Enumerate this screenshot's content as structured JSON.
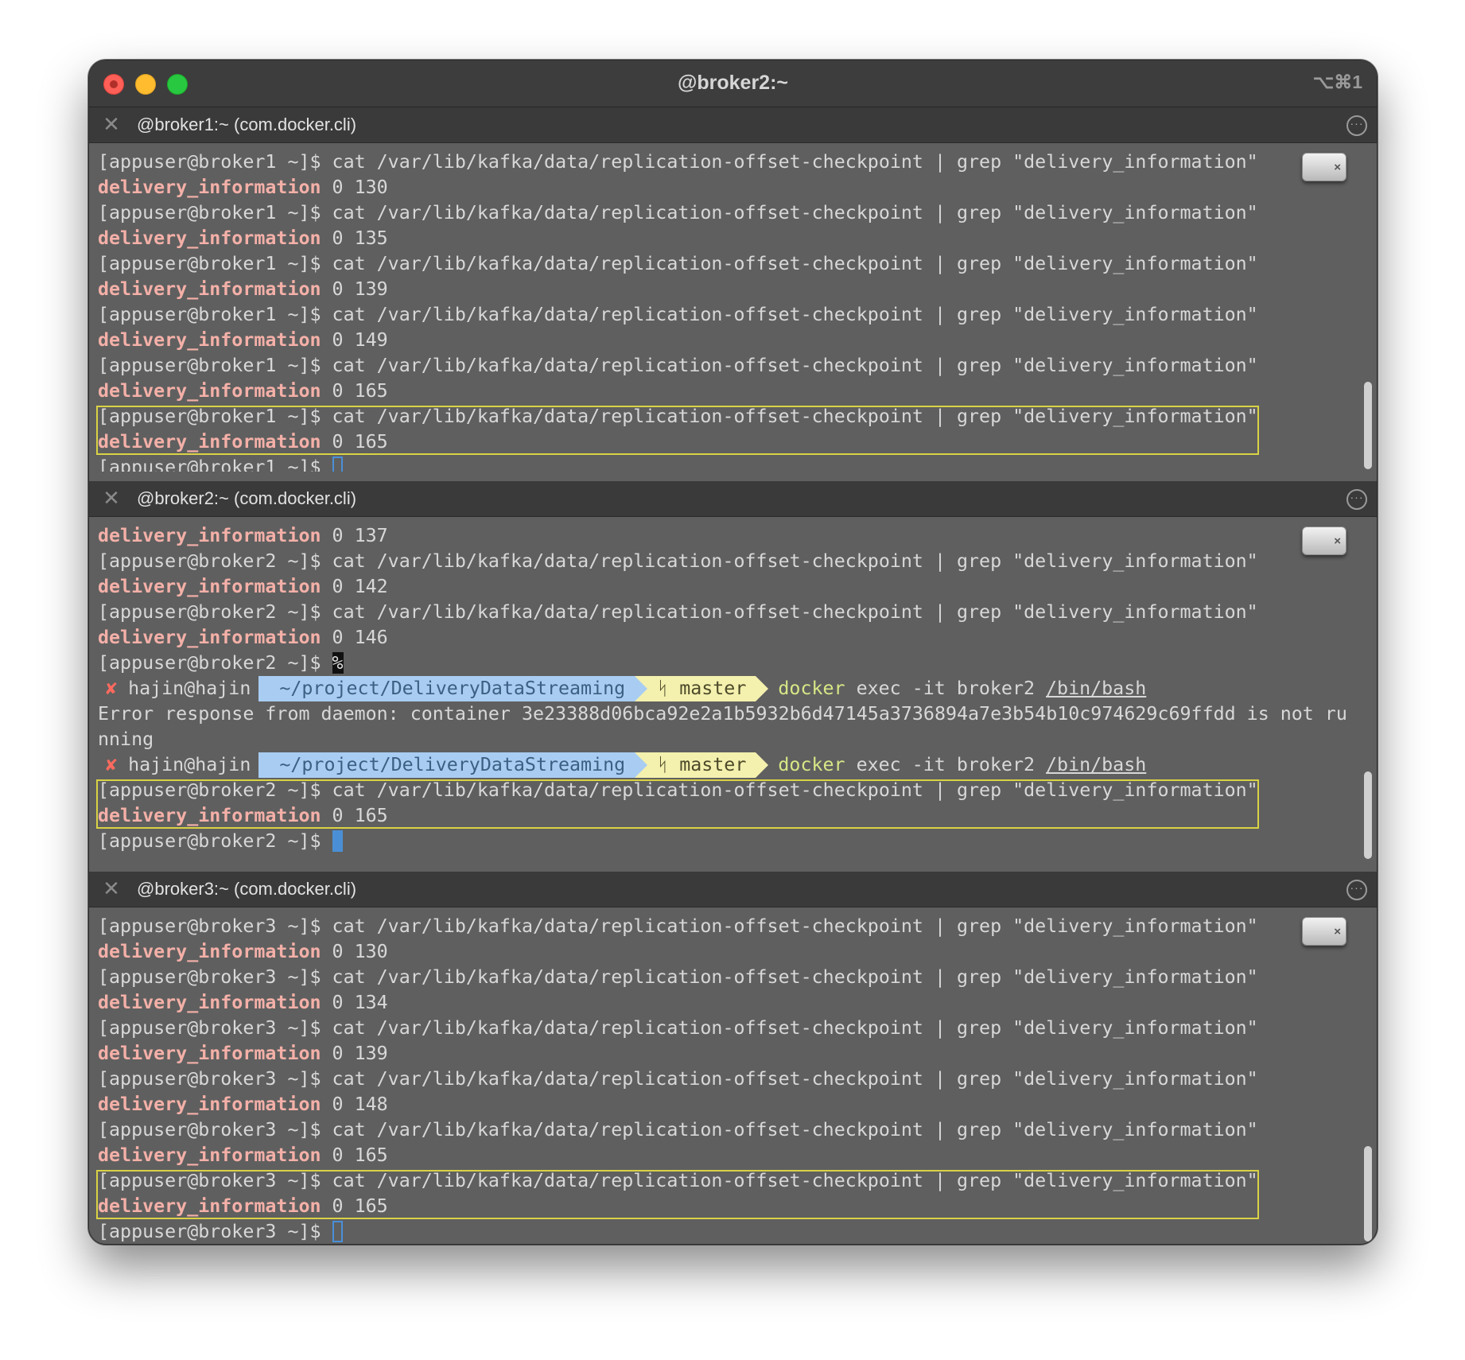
{
  "window": {
    "title": "@broker2:~",
    "shortcut": "⌥⌘1"
  },
  "icons": {
    "close": "close-icon",
    "more": "more-options-icon",
    "eject": "eject-icon"
  },
  "panes": [
    {
      "title": "@broker1:~ (com.docker.cli)",
      "lines": [
        {
          "t": "cmd",
          "prompt": "[appuser@broker1 ~]$ ",
          "text": "cat /var/lib/kafka/data/replication-offset-checkpoint | grep \"delivery_information\""
        },
        {
          "t": "out",
          "topic": "delivery_information",
          "rest": " 0 130"
        },
        {
          "t": "cmd",
          "prompt": "[appuser@broker1 ~]$ ",
          "text": "cat /var/lib/kafka/data/replication-offset-checkpoint | grep \"delivery_information\""
        },
        {
          "t": "out",
          "topic": "delivery_information",
          "rest": " 0 135"
        },
        {
          "t": "cmd",
          "prompt": "[appuser@broker1 ~]$ ",
          "text": "cat /var/lib/kafka/data/replication-offset-checkpoint | grep \"delivery_information\""
        },
        {
          "t": "out",
          "topic": "delivery_information",
          "rest": " 0 139"
        },
        {
          "t": "cmd",
          "prompt": "[appuser@broker1 ~]$ ",
          "text": "cat /var/lib/kafka/data/replication-offset-checkpoint | grep \"delivery_information\""
        },
        {
          "t": "out",
          "topic": "delivery_information",
          "rest": " 0 149"
        },
        {
          "t": "cmd",
          "prompt": "[appuser@broker1 ~]$ ",
          "text": "cat /var/lib/kafka/data/replication-offset-checkpoint | grep \"delivery_information\""
        },
        {
          "t": "out",
          "topic": "delivery_information",
          "rest": " 0 165"
        },
        {
          "t": "cmd",
          "prompt": "[appuser@broker1 ~]$ ",
          "text": "cat /var/lib/kafka/data/replication-offset-checkpoint | grep \"delivery_information\""
        },
        {
          "t": "out",
          "topic": "delivery_information",
          "rest": " 0 165"
        },
        {
          "t": "prompt",
          "prompt": "[appuser@broker1 ~]$ ",
          "cursor": "hollow"
        }
      ]
    },
    {
      "title": "@broker2:~ (com.docker.cli)",
      "lines": [
        {
          "t": "out",
          "topic": "delivery_information",
          "rest": " 0 137"
        },
        {
          "t": "cmd",
          "prompt": "[appuser@broker2 ~]$ ",
          "text": "cat /var/lib/kafka/data/replication-offset-checkpoint | grep \"delivery_information\""
        },
        {
          "t": "out",
          "topic": "delivery_information",
          "rest": " 0 142"
        },
        {
          "t": "cmd",
          "prompt": "[appuser@broker2 ~]$ ",
          "text": "cat /var/lib/kafka/data/replication-offset-checkpoint | grep \"delivery_information\""
        },
        {
          "t": "out",
          "topic": "delivery_information",
          "rest": " 0 146"
        },
        {
          "t": "pct",
          "prompt": "[appuser@broker2 ~]$ ",
          "mark": "%"
        },
        {
          "t": "zsh",
          "user": "hajin@hajin",
          "path": "~/project/DeliveryDataStreaming",
          "branch": "master",
          "cmd": "docker",
          "args": " exec -it broker2 ",
          "shell": "/bin/bash"
        },
        {
          "t": "plain",
          "text": "Error response from daemon: container 3e23388d06bca92e2a1b5932b6d47145a3736894a7e3b54b10c974629c69ffdd is not ru"
        },
        {
          "t": "plain",
          "text": "nning"
        },
        {
          "t": "zsh",
          "user": "hajin@hajin",
          "path": "~/project/DeliveryDataStreaming",
          "branch": "master",
          "cmd": "docker",
          "args": " exec -it broker2 ",
          "shell": "/bin/bash"
        },
        {
          "t": "cmd",
          "prompt": "[appuser@broker2 ~]$ ",
          "text": "cat /var/lib/kafka/data/replication-offset-checkpoint | grep \"delivery_information\""
        },
        {
          "t": "out",
          "topic": "delivery_information",
          "rest": " 0 165"
        },
        {
          "t": "prompt",
          "prompt": "[appuser@broker2 ~]$ ",
          "cursor": "solid"
        }
      ]
    },
    {
      "title": "@broker3:~ (com.docker.cli)",
      "lines": [
        {
          "t": "cmd",
          "prompt": "[appuser@broker3 ~]$ ",
          "text": "cat /var/lib/kafka/data/replication-offset-checkpoint | grep \"delivery_information\""
        },
        {
          "t": "out",
          "topic": "delivery_information",
          "rest": " 0 130"
        },
        {
          "t": "cmd",
          "prompt": "[appuser@broker3 ~]$ ",
          "text": "cat /var/lib/kafka/data/replication-offset-checkpoint | grep \"delivery_information\""
        },
        {
          "t": "out",
          "topic": "delivery_information",
          "rest": " 0 134"
        },
        {
          "t": "cmd",
          "prompt": "[appuser@broker3 ~]$ ",
          "text": "cat /var/lib/kafka/data/replication-offset-checkpoint | grep \"delivery_information\""
        },
        {
          "t": "out",
          "topic": "delivery_information",
          "rest": " 0 139"
        },
        {
          "t": "cmd",
          "prompt": "[appuser@broker3 ~]$ ",
          "text": "cat /var/lib/kafka/data/replication-offset-checkpoint | grep \"delivery_information\""
        },
        {
          "t": "out",
          "topic": "delivery_information",
          "rest": " 0 148"
        },
        {
          "t": "cmd",
          "prompt": "[appuser@broker3 ~]$ ",
          "text": "cat /var/lib/kafka/data/replication-offset-checkpoint | grep \"delivery_information\""
        },
        {
          "t": "out",
          "topic": "delivery_information",
          "rest": " 0 165"
        },
        {
          "t": "cmd",
          "prompt": "[appuser@broker3 ~]$ ",
          "text": "cat /var/lib/kafka/data/replication-offset-checkpoint | grep \"delivery_information\""
        },
        {
          "t": "out",
          "topic": "delivery_information",
          "rest": " 0 165"
        },
        {
          "t": "prompt",
          "prompt": "[appuser@broker3 ~]$ ",
          "cursor": "hollow"
        }
      ]
    }
  ]
}
